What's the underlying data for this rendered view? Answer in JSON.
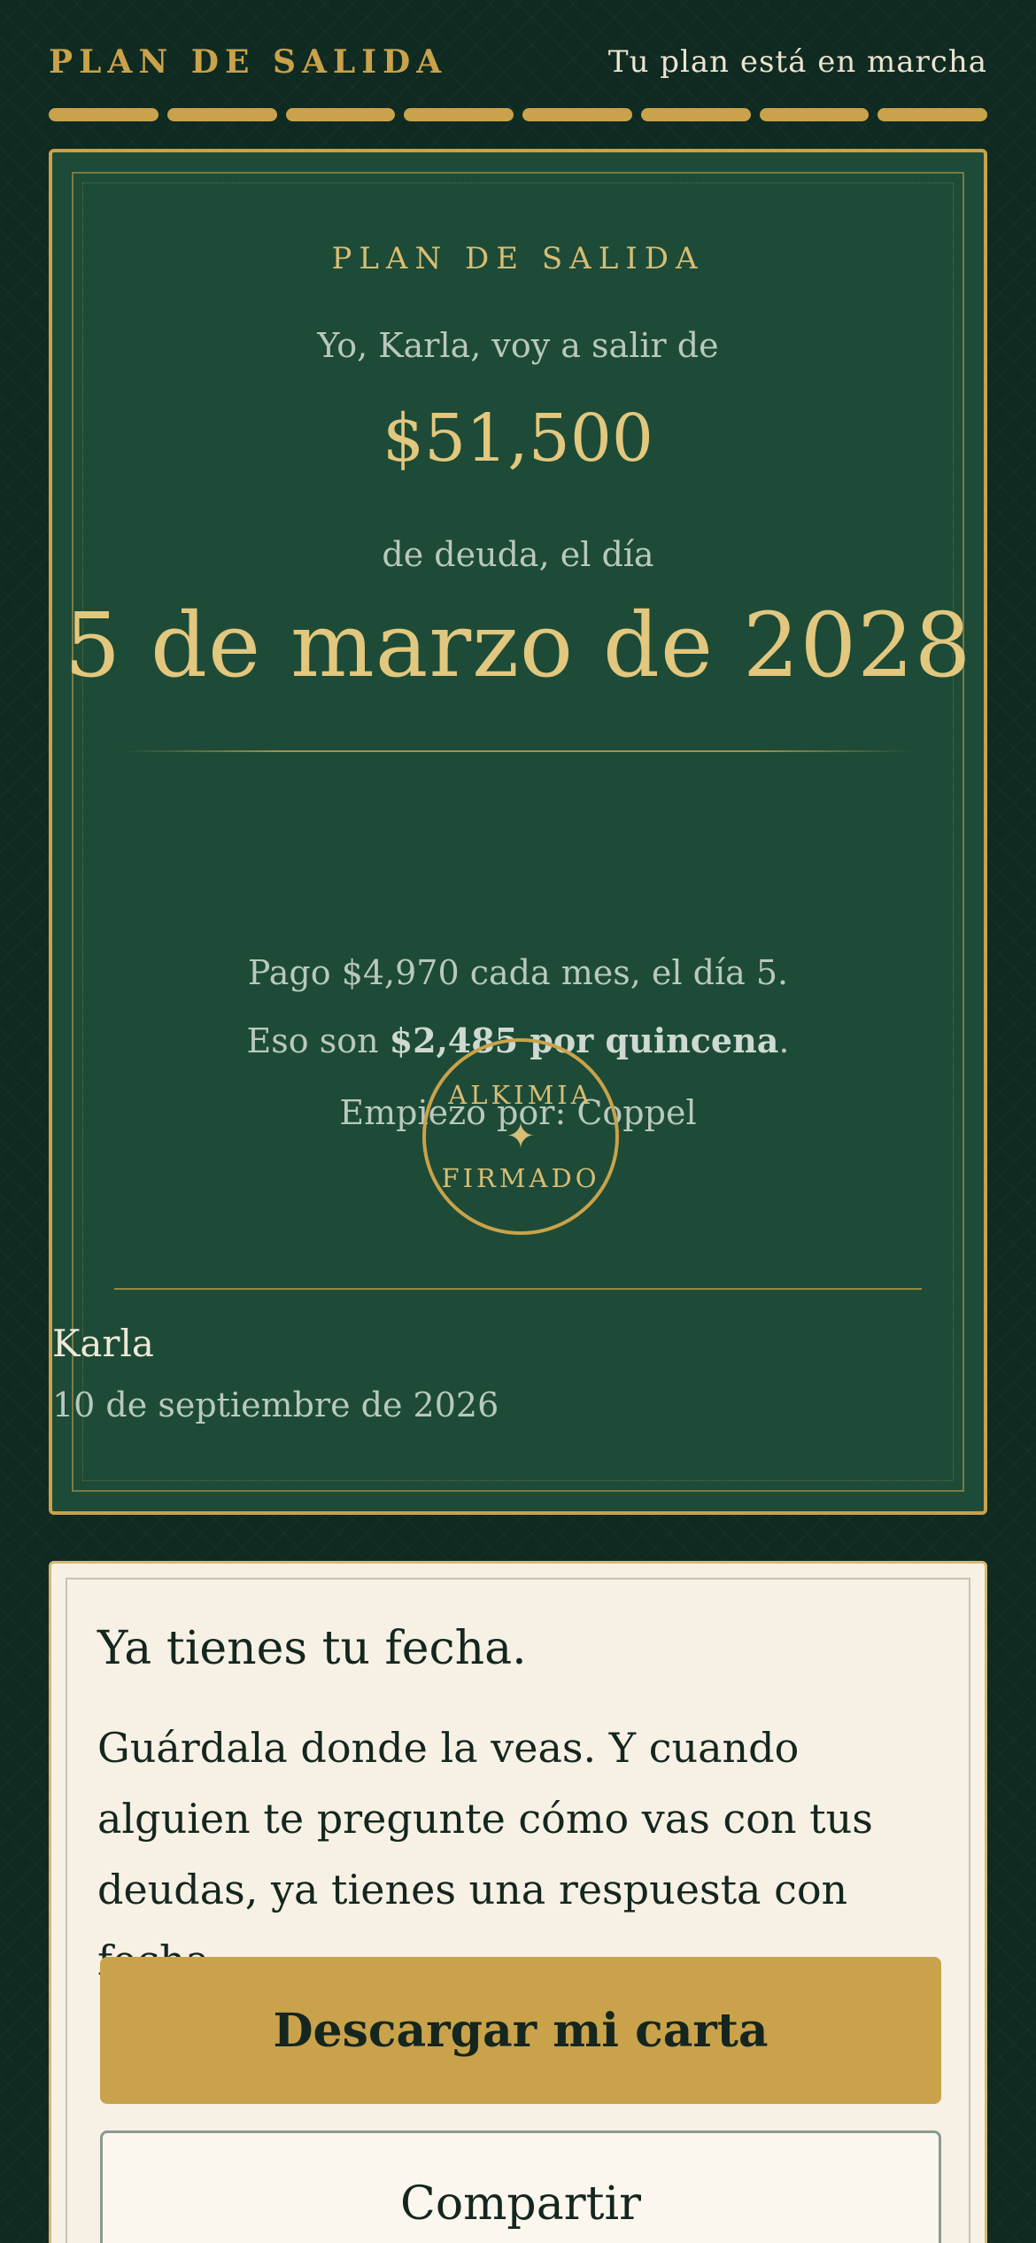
{
  "header": {
    "brand": "PLAN DE SALIDA",
    "status": "Tu plan está en marcha",
    "progress_steps_total": 8,
    "progress_steps_done": 8
  },
  "certificate": {
    "title": "PLAN DE SALIDA",
    "intro": "Yo, Karla, voy a salir de",
    "amount": "$51,500",
    "debt_text": "de deuda, el día",
    "exit_date": "5 de marzo de 2028",
    "payment_line": "Pago $4,970 cada mes, el día 5.",
    "biweekly_prefix": "Eso son ",
    "biweekly_amount": "$2,485 por quincena",
    "biweekly_suffix": ".",
    "start_line": "Empiezo por: Coppel",
    "seal_top": "ALKIMIA",
    "seal_star": "✦",
    "seal_bottom": "FIRMADO",
    "signer": "Karla",
    "sign_date": "10 de septiembre de 2026"
  },
  "panel": {
    "heading": "Ya tienes tu fecha.",
    "body": "Guárdala donde la veas. Y cuando alguien te pregunte cómo vas con tus deudas, ya tienes una respuesta con fecha.",
    "download_label": "Descargar mi carta",
    "share_label": "Compartir"
  },
  "colors": {
    "background": "#0f2a20",
    "card": "#1d4b37",
    "gold": "#c9a24b",
    "cream": "#f7f1e5"
  }
}
